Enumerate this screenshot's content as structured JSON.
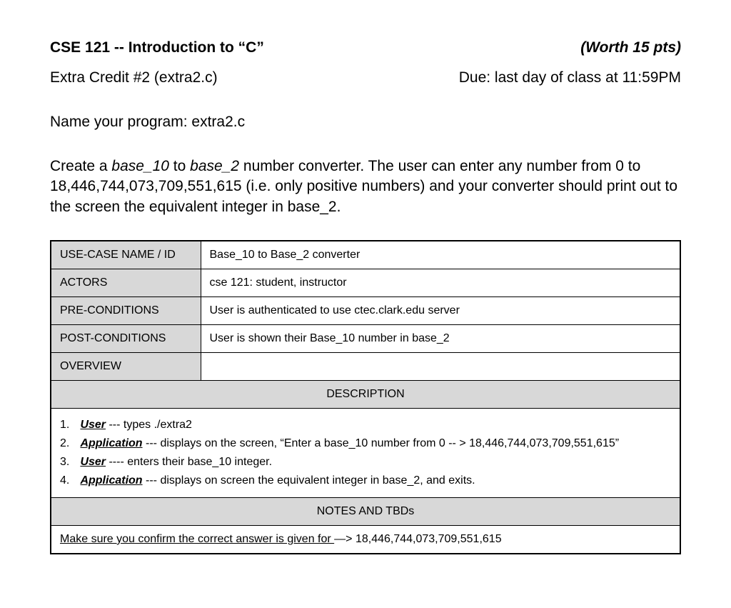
{
  "header": {
    "course_title": "CSE 121 --  Introduction to “C”",
    "worth": "(Worth 15 pts)",
    "extra_credit": "Extra Credit #2  (extra2.c)",
    "due": "Due: last day of class at 11:59PM"
  },
  "name_program_label": "Name your program:   extra2.c",
  "description": {
    "prefix": "Create a ",
    "base10": "base_10",
    "mid1": " to ",
    "base2": "base_2",
    "rest": " number converter. The user can enter any number from 0 to 18,446,744,073,709,551,615 (i.e. only positive numbers) and your converter should print out to the screen the equivalent integer in base_2."
  },
  "table": {
    "rows": [
      {
        "label": "USE-CASE NAME / ID",
        "value": "Base_10 to Base_2 converter"
      },
      {
        "label": "ACTORS",
        "value": "cse 121:  student,  instructor"
      },
      {
        "label": "PRE-CONDITIONS",
        "value": "User is authenticated to use ctec.clark.edu server"
      },
      {
        "label": "POST-CONDITIONS",
        "value": "User is shown their Base_10 number in base_2"
      },
      {
        "label": "OVERVIEW",
        "value": ""
      }
    ],
    "description_header": "DESCRIPTION",
    "steps": [
      {
        "num": "1.",
        "actor": "User",
        "text": "  --- types  ./extra2"
      },
      {
        "num": "2.",
        "actor": "Application",
        "text": " --- displays on the screen, “Enter a base_10 number from 0 -- > 18,446,744,073,709,551,615”"
      },
      {
        "num": "3.",
        "actor": "User",
        "text": " ---- enters their base_10 integer."
      },
      {
        "num": "4.",
        "actor": "Application",
        "text": " --- displays on screen the equivalent integer in base_2, and exits."
      }
    ],
    "notes_header": "NOTES AND TBDs",
    "notes_underline": "Make sure you confirm the correct answer is given for ",
    "notes_rest": "—>  18,446,744,073,709,551,615"
  }
}
